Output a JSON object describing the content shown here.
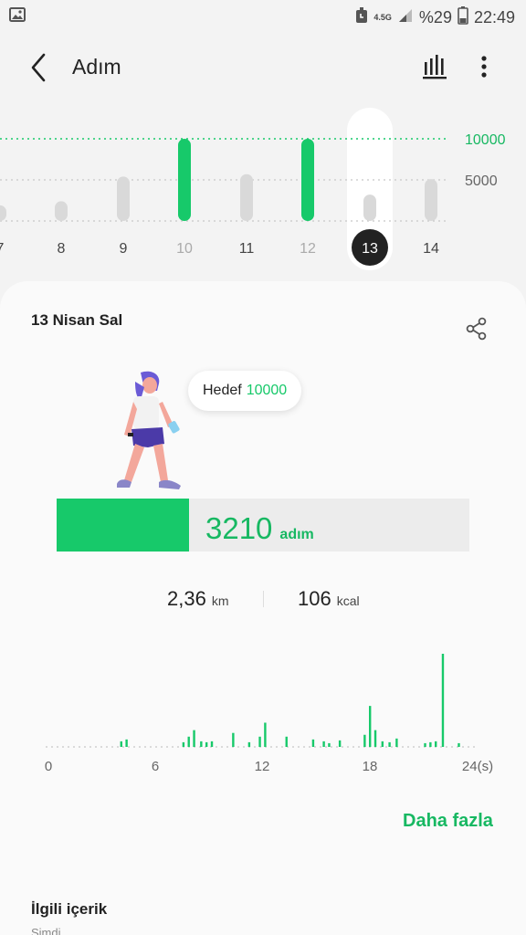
{
  "status_bar": {
    "network": "4.5G",
    "battery": "%29",
    "time": "22:49"
  },
  "header": {
    "title": "Adım",
    "back_icon": "chevron-left-icon",
    "chart_icon": "bar-chart-icon",
    "menu_icon": "more-vert-icon"
  },
  "week_chart": {
    "days": [
      {
        "label": "7",
        "steps": 1900,
        "goal_met": false
      },
      {
        "label": "8",
        "steps": 2400,
        "goal_met": false
      },
      {
        "label": "9",
        "steps": 5400,
        "goal_met": false
      },
      {
        "label": "10",
        "steps": 10000,
        "goal_met": true
      },
      {
        "label": "11",
        "steps": 5700,
        "goal_met": false
      },
      {
        "label": "12",
        "steps": 10000,
        "goal_met": true
      },
      {
        "label": "13",
        "steps": 3210,
        "goal_met": false,
        "selected": true
      },
      {
        "label": "14",
        "steps": 5100,
        "goal_met": false
      }
    ],
    "goal_label": "10000",
    "mid_label": "5000",
    "goal": 10000,
    "colors": {
      "goal": "#17c96a",
      "normal": "#d9d9d9",
      "selected": "#222222"
    }
  },
  "detail": {
    "date": "13 Nisan Sal",
    "share_icon": "share-icon",
    "illustration": "walking-woman-illustration",
    "goal_label": "Hedef",
    "goal_value": "10000",
    "steps": "3210",
    "steps_unit": "adım",
    "progress": 0.321,
    "distance": "2,36",
    "distance_unit": "km",
    "calories": "106",
    "calories_unit": "kcal"
  },
  "hourly_chart": {
    "x_labels": [
      "0",
      "6",
      "12",
      "18",
      "24(s)"
    ],
    "max": 1000,
    "bars": [
      {
        "h": 4.1,
        "v": 60
      },
      {
        "h": 4.4,
        "v": 80
      },
      {
        "h": 7.6,
        "v": 50
      },
      {
        "h": 7.9,
        "v": 110
      },
      {
        "h": 8.2,
        "v": 180
      },
      {
        "h": 8.6,
        "v": 60
      },
      {
        "h": 8.9,
        "v": 50
      },
      {
        "h": 9.2,
        "v": 60
      },
      {
        "h": 10.4,
        "v": 150
      },
      {
        "h": 11.3,
        "v": 50
      },
      {
        "h": 11.9,
        "v": 110
      },
      {
        "h": 12.2,
        "v": 260
      },
      {
        "h": 13.4,
        "v": 110
      },
      {
        "h": 14.9,
        "v": 80
      },
      {
        "h": 15.5,
        "v": 60
      },
      {
        "h": 15.8,
        "v": 40
      },
      {
        "h": 16.4,
        "v": 70
      },
      {
        "h": 17.8,
        "v": 130
      },
      {
        "h": 18.1,
        "v": 440
      },
      {
        "h": 18.4,
        "v": 180
      },
      {
        "h": 18.8,
        "v": 60
      },
      {
        "h": 19.2,
        "v": 50
      },
      {
        "h": 19.6,
        "v": 90
      },
      {
        "h": 21.2,
        "v": 40
      },
      {
        "h": 21.5,
        "v": 50
      },
      {
        "h": 21.8,
        "v": 60
      },
      {
        "h": 22.2,
        "v": 1000
      },
      {
        "h": 23.1,
        "v": 40
      }
    ],
    "color": "#17c96a"
  },
  "more_link": "Daha fazla",
  "related": {
    "title": "İlgili içerik",
    "subtitle": "Şimdi"
  }
}
